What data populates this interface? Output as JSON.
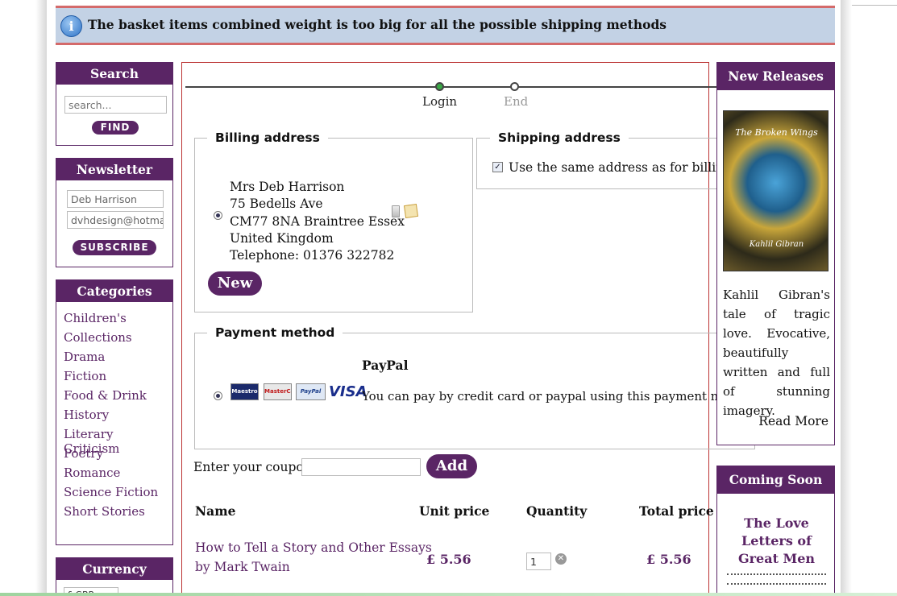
{
  "notice": {
    "message": "The basket items combined weight is too big for all the possible shipping methods",
    "icon": "info-icon"
  },
  "search": {
    "title": "Search",
    "placeholder": "search...",
    "button": "FIND"
  },
  "newsletter": {
    "title": "Newsletter",
    "name_value": "Deb Harrison",
    "email_value": "dvhdesign@hotma",
    "button": "SUBSCRIBE"
  },
  "categories": {
    "title": "Categories",
    "items": [
      "Children's",
      "Collections",
      "Drama",
      "Fiction",
      "Food & Drink",
      "History",
      "Literary Criticism",
      "Poetry",
      "Romance",
      "Science Fiction",
      "Short Stories"
    ]
  },
  "currency": {
    "title": "Currency",
    "selected": "£ GBP"
  },
  "steps": [
    {
      "label": "Login",
      "state": "active"
    },
    {
      "label": "End",
      "state": "inactive"
    }
  ],
  "billing": {
    "legend": "Billing address",
    "lines": [
      "Mrs Deb Harrison",
      "75 Bedells Ave",
      "CM77 8NA Braintree Essex",
      "United Kingdom",
      "Telephone: 01376 322782"
    ],
    "new_button": "New"
  },
  "shipping": {
    "legend": "Shipping address",
    "same_label": "Use the same address as for billing",
    "same_checked": true
  },
  "payment": {
    "legend": "Payment method",
    "name": "PayPal",
    "description": "You can pay by credit card or paypal using this payment method",
    "cards": [
      "Maestro",
      "MasterCard",
      "PayPal",
      "VISA"
    ]
  },
  "coupon": {
    "label": "Enter your coupon",
    "value": "",
    "button": "Add"
  },
  "table": {
    "headers": [
      "Name",
      "Unit price",
      "Quantity",
      "Total price"
    ],
    "rows": [
      {
        "name_line1": "How to Tell a Story and Other Essays",
        "name_line2": "by Mark Twain",
        "unit_price": "£ 5.56",
        "quantity": "1",
        "total_price": "£ 5.56"
      }
    ]
  },
  "new_releases": {
    "title": "New Releases",
    "cover_title": "The Broken Wings",
    "cover_author": "Kahlil Gibran",
    "description": "Kahlil Gibran's tale of tragic love. Evocative, beautifully written and full of stunning imagery.",
    "read_more": "Read More"
  },
  "coming_soon": {
    "title": "Coming Soon",
    "book_title": "The Love Letters of Great Men"
  },
  "colors": {
    "brand": "#5a2565",
    "notice_bg": "#c3d2e5",
    "notice_border": "#d46a6a",
    "main_border": "#bb3333"
  }
}
